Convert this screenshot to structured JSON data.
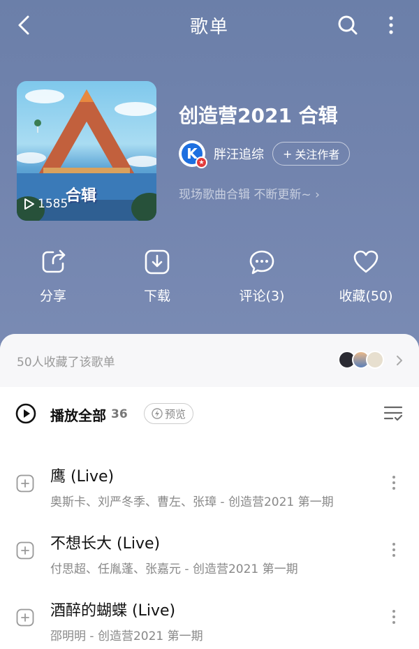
{
  "header": {
    "title": "歌单",
    "back_icon": "back-chevron-icon",
    "search_icon": "search-icon",
    "more_icon": "more-vertical-icon"
  },
  "playlist": {
    "cover_caption": "合辑",
    "play_count": "1585",
    "title": "创造营2021 合辑",
    "author_avatar_letter": "K",
    "author_name": "胖汪追综",
    "follow_label": "关注作者",
    "description": "现场歌曲合辑 不断更新~"
  },
  "actions": [
    {
      "label": "分享",
      "icon": "share-icon"
    },
    {
      "label": "下载",
      "icon": "download-icon"
    },
    {
      "label": "评论(3)",
      "icon": "comment-icon"
    },
    {
      "label": "收藏(50)",
      "icon": "heart-icon"
    }
  ],
  "collectors": {
    "text": "50人收藏了该歌单"
  },
  "play_all": {
    "label": "播放全部",
    "count": "36",
    "preview_label": "预览"
  },
  "songs": [
    {
      "title": "鹰 (Live)",
      "meta": "奥斯卡、刘严冬季、曹左、张璋 - 创造营2021 第一期"
    },
    {
      "title": "不想长大 (Live)",
      "meta": "付思超、任胤蓬、张嘉元 - 创造营2021 第一期"
    },
    {
      "title": "酒醉的蝴蝶 (Live)",
      "meta": "邵明明 - 创造营2021 第一期"
    }
  ],
  "colors": {
    "hero_bg": "#7183ad",
    "author_badge": "#1d6fe0",
    "verified_badge": "#e23b3b"
  }
}
